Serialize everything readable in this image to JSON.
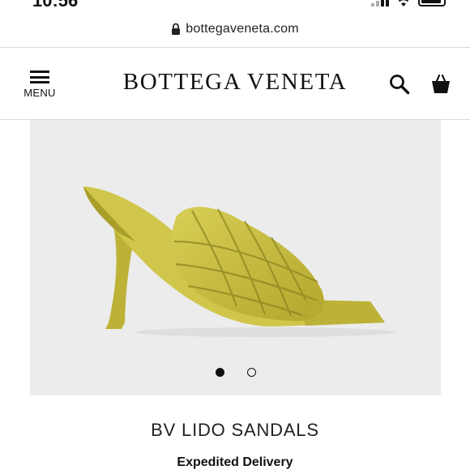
{
  "status_bar": {
    "time": "10:56"
  },
  "browser": {
    "url": "bottegaveneta.com"
  },
  "header": {
    "menu_label": "MENU",
    "brand": "BOTTEGA VENETA",
    "icons": [
      "menu-icon",
      "search-icon",
      "shopping-bag-icon"
    ]
  },
  "product": {
    "name": "BV LIDO SANDALS",
    "image_count": 2,
    "active_image": 1,
    "image_color": "#c9be3f"
  },
  "delivery": {
    "label": "Expedited Delivery"
  }
}
